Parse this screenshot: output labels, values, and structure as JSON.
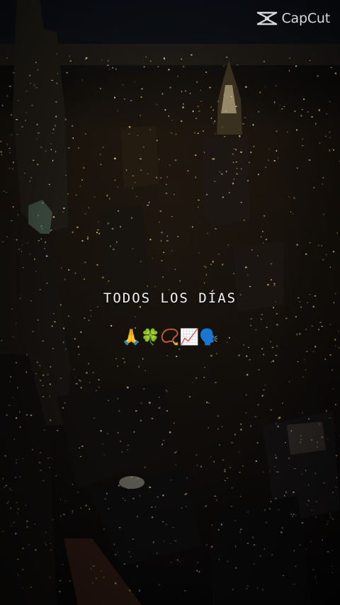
{
  "watermark": {
    "brand": "CapCut",
    "icon": "capcut-logo-icon"
  },
  "caption": {
    "text": "TODOS LOS DÍAS"
  },
  "emojis": {
    "text": "🙏🍀📿📈🗣️"
  },
  "colors": {
    "window_light": "#f0c878",
    "window_light_cool": "#e8ecff",
    "sky": "#0a0d14",
    "caption_text": "#f4f4f4"
  }
}
